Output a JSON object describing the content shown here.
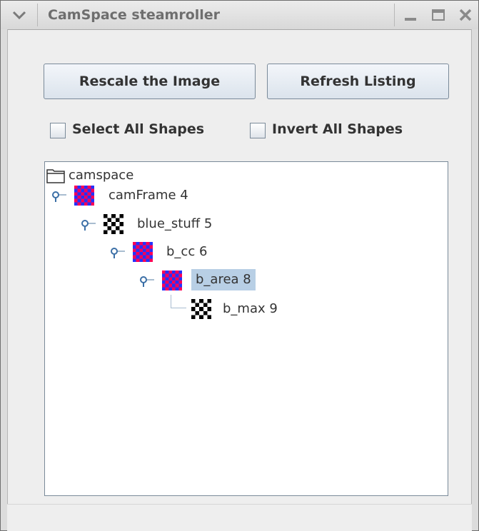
{
  "window": {
    "title": "CamSpace steamroller"
  },
  "toolbar": {
    "rescale_label": "Rescale the Image",
    "refresh_label": "Refresh Listing"
  },
  "options": {
    "select_all_label": "Select All Shapes",
    "select_all_checked": false,
    "invert_all_label": "Invert All Shapes",
    "invert_all_checked": false
  },
  "tree": {
    "root": "camspace",
    "nodes": [
      {
        "label": "camFrame 4",
        "icon": "red-blue-checker-icon",
        "expanded": true
      },
      {
        "label": "blue_stuff 5",
        "icon": "black-white-checker-icon",
        "expanded": true
      },
      {
        "label": "b_cc 6",
        "icon": "red-blue-checker-icon",
        "expanded": true
      },
      {
        "label": "b_area 8",
        "icon": "red-blue-checker-icon",
        "expanded": true,
        "selected": true
      },
      {
        "label": "b_max 9",
        "icon": "black-white-checker-icon",
        "leaf": true
      }
    ]
  },
  "colors": {
    "selection": "#b8cfe5",
    "checker_red": "#ff0055",
    "checker_blue": "#2233ff"
  }
}
